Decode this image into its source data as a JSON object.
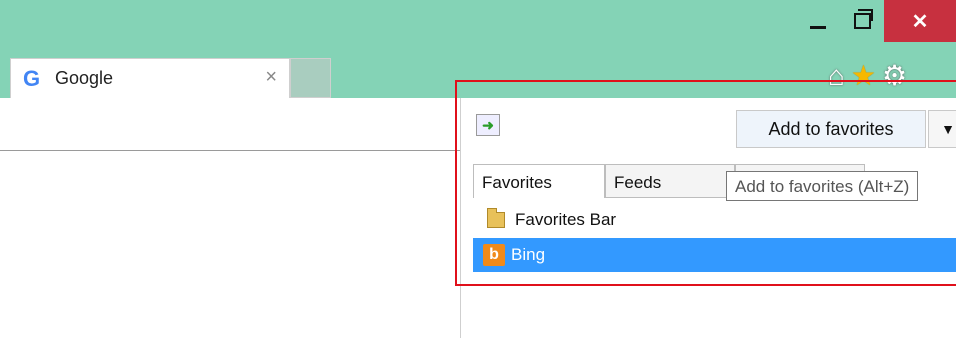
{
  "window": {
    "close_label": "✕"
  },
  "tab": {
    "title": "Google",
    "logo_letter": "G",
    "close_label": "×"
  },
  "favorites_panel": {
    "back_arrow": "➜",
    "add_button_label": "Add to favorites",
    "dropdown_arrow": "▼",
    "tabs": [
      {
        "label": "Favorites"
      },
      {
        "label": "Feeds"
      },
      {
        "label": ""
      }
    ],
    "tooltip": "Add to favorites (Alt+Z)",
    "items": [
      {
        "label": "Favorites Bar",
        "icon": "folder-icon"
      },
      {
        "label": "Bing",
        "icon": "bing-icon"
      }
    ]
  },
  "colors": {
    "titlebar": "#84d3b6",
    "close_button": "#c7303f",
    "selection": "#3399ff",
    "highlight_box": "#e0101b"
  }
}
